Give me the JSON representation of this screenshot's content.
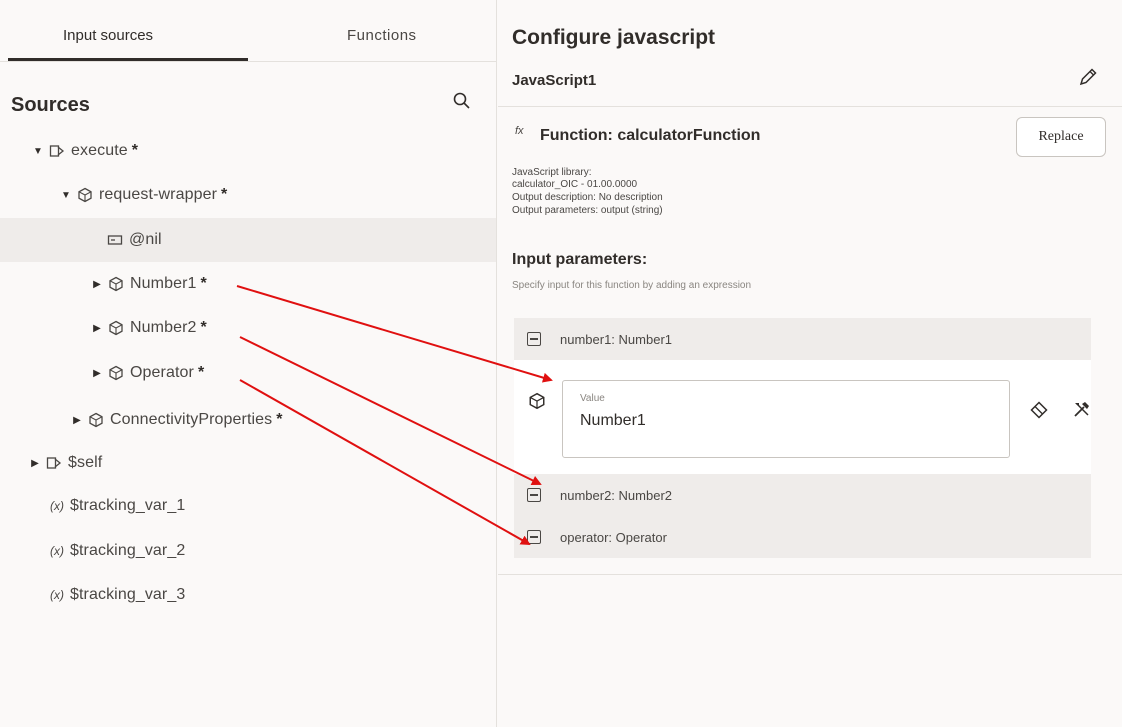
{
  "tabs": {
    "input_sources": "Input sources",
    "functions": "Functions"
  },
  "sources": {
    "heading": "Sources",
    "tree": {
      "execute": "execute",
      "request_wrapper": "request-wrapper",
      "nil": "@nil",
      "number1": "Number1",
      "number2": "Number2",
      "operator": "Operator",
      "connectivity": "ConnectivityProperties",
      "self": "$self",
      "var_prefix": "(x)",
      "tracking1": "$tracking_var_1",
      "tracking2": "$tracking_var_2",
      "tracking3": "$tracking_var_3",
      "required_marker": "*"
    }
  },
  "config": {
    "title": "Configure javascript",
    "name": "JavaScript1",
    "fx": "fx",
    "function_title": "Function: calculatorFunction",
    "replace_label": "Replace",
    "meta": [
      "JavaScript library:",
      "calculator_OIC - 01.00.0000",
      "Output description: No description",
      "Output parameters: output (string)"
    ],
    "input_params_title": "Input parameters:",
    "input_params_help": "Specify input for this function by adding an expression",
    "params": [
      {
        "header": "number1: Number1",
        "value_label": "Value",
        "value": "Number1"
      },
      {
        "header": "number2: Number2"
      },
      {
        "header": "operator: Operator"
      }
    ]
  },
  "colors": {
    "arrow": "#e01010",
    "highlight_row": "#efecea",
    "text": "#312d2a"
  }
}
